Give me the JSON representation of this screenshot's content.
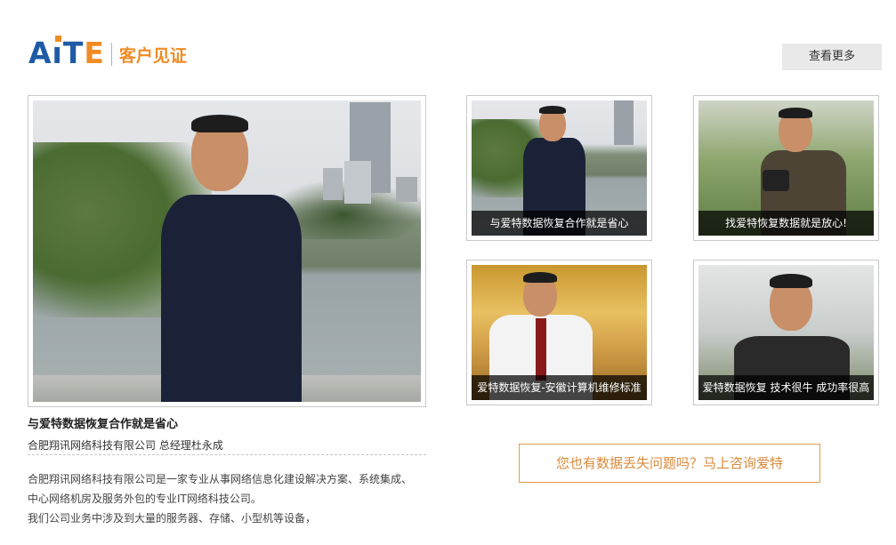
{
  "header": {
    "logo_text": "AiTE",
    "section_title": "客户见证",
    "more_label": "查看更多"
  },
  "featured": {
    "caption": "",
    "title": "与爱特数据恢复合作就是省心",
    "author": "合肥翔讯网络科技有限公司 总经理杜永成",
    "body": [
      "合肥翔讯网络科技有限公司是一家专业从事网络信息化建设解决方案、系统集成、",
      "中心网络机房及服务外包的专业IT网络科技公司。",
      "我们公司业务中涉及到大量的服务器、存储、小型机等设备，"
    ]
  },
  "testimonials": [
    {
      "caption": "与爱特数据恢复合作就是省心"
    },
    {
      "caption": "找爱特恢复数据就是放心!"
    },
    {
      "caption": "爱特数据恢复-安徽计算机维修标准"
    },
    {
      "caption": "爱特数据恢复 技术很牛 成功率很高"
    }
  ],
  "cta": {
    "label": "您也有数据丢失问题吗？马上咨询爱特"
  },
  "colors": {
    "brand_blue": "#1f5aa6",
    "brand_orange": "#f08c24",
    "cta_text": "#d98a3a"
  }
}
